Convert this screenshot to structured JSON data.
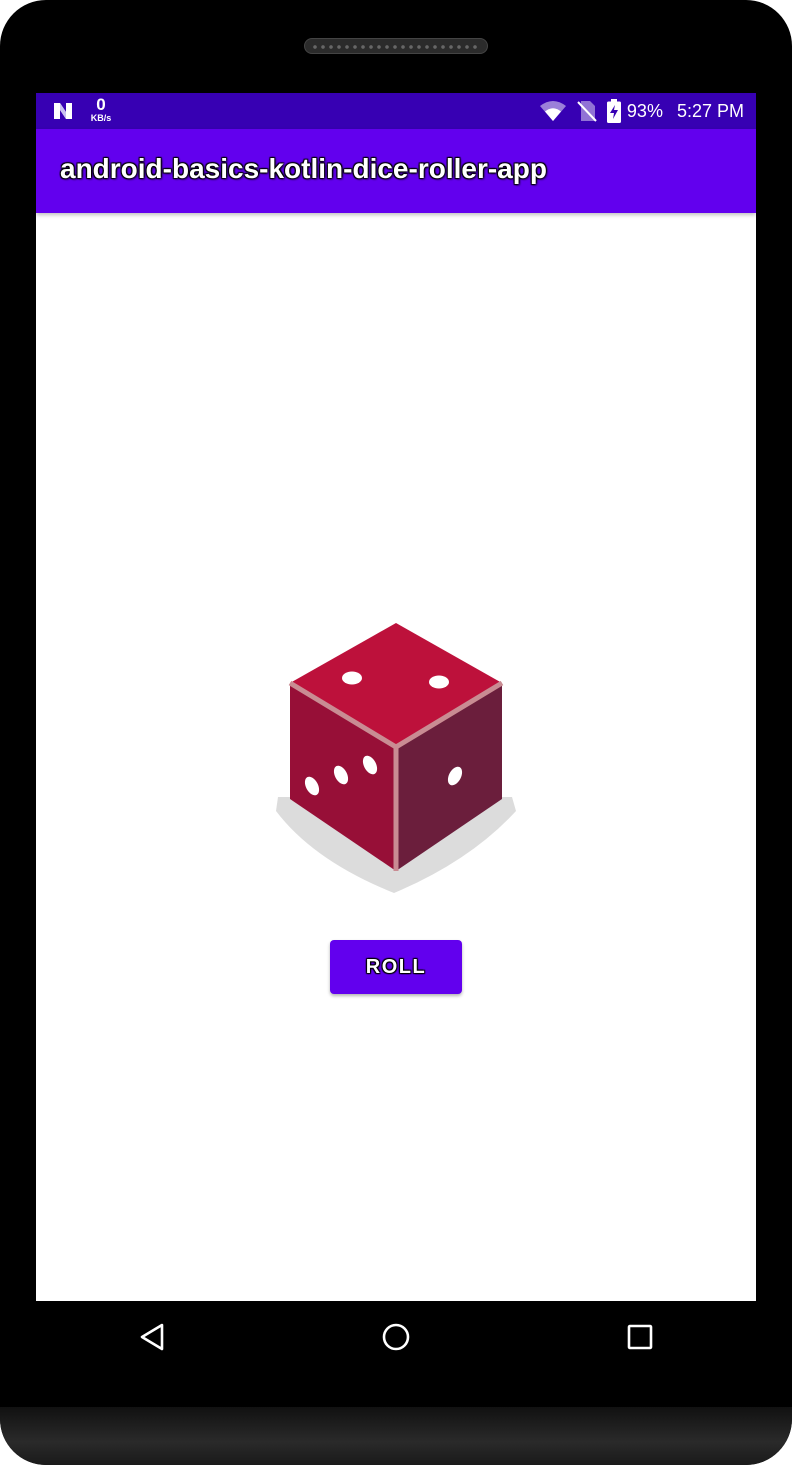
{
  "status_bar": {
    "network_logo_icon": "n-logo-icon",
    "net_speed_value": "0",
    "net_speed_unit": "KB/s",
    "icons": [
      "wifi-icon",
      "no-sim-icon",
      "battery-charging-icon"
    ],
    "battery_percent": "93%",
    "time": "5:27 PM",
    "background_color": "#3700b3"
  },
  "app_bar": {
    "title": "android-basics-kotlin-dice-roller-app",
    "background_color": "#6200ee"
  },
  "main": {
    "dice_image": {
      "icon": "dice-icon",
      "face_value": 2,
      "colors": {
        "top": "#bd113b",
        "left": "#970f37",
        "right": "#6b1e3c",
        "edge": "#c98c93",
        "shadow": "#dcdcdc"
      }
    },
    "roll_button": {
      "label": "ROLL",
      "background_color": "#6200ee"
    }
  },
  "nav_bar": {
    "buttons": [
      "back-icon",
      "home-icon",
      "recents-icon"
    ]
  }
}
